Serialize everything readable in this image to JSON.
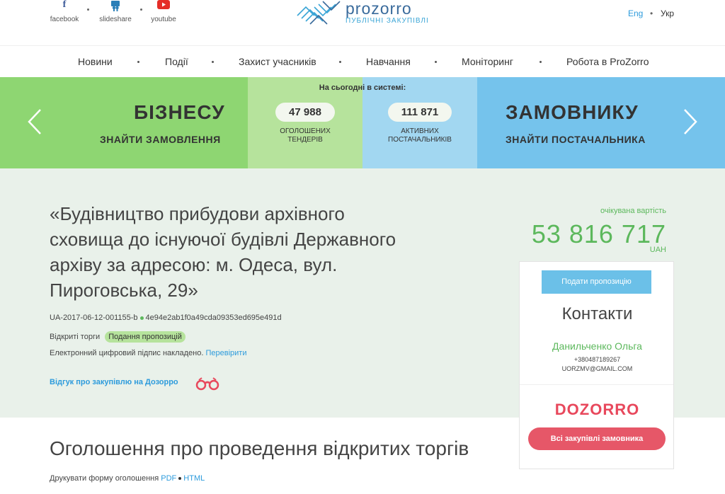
{
  "header": {
    "social": [
      {
        "label": "facebook",
        "icon": "facebook-icon"
      },
      {
        "label": "slideshare",
        "icon": "slideshare-icon"
      },
      {
        "label": "youtube",
        "icon": "youtube-icon"
      }
    ],
    "logo_name": "prozorro",
    "logo_sub": "ПУБЛІЧНІ ЗАКУПІВЛІ",
    "lang_en": "Eng",
    "lang_uk": "Укр"
  },
  "nav": {
    "items": [
      "Новини",
      "Події",
      "Захист учасників",
      "Навчання",
      "Моніторинг",
      "Робота в ProZorro"
    ]
  },
  "banner": {
    "business_title": "БІЗНЕСУ",
    "business_sub": "ЗНАЙТИ ЗАМОВЛЕННЯ",
    "stats_header": "На сьогодні в системі:",
    "tenders_count": "47 988",
    "tenders_label_1": "ОГОЛОШЕНИХ",
    "tenders_label_2": "ТЕНДЕРІВ",
    "suppliers_count": "111 871",
    "suppliers_label_1": "АКТИВНИХ",
    "suppliers_label_2": "ПОСТАЧАЛЬНИКІВ",
    "customer_title": "ЗАМОВНИКУ",
    "customer_sub": "ЗНАЙТИ ПОСТАЧАЛЬНИКА"
  },
  "tender": {
    "title": "«Будівництво прибудови архівного сховища до існуючої будівлі Державного архіву за адресою: м. Одеса, вул. Пироговська, 29»",
    "id": "UA-2017-06-12-001155-b",
    "hash": "4e94e2ab1f0a49cda09353ed695e491d",
    "type": "Відкриті торги",
    "status": "Подання пропозицій",
    "sign_text": "Електронний цифровий підпис накладено.",
    "sign_link": "Перевірити",
    "review_link": "Відгук про закупівлю на Дозорро",
    "expected_label": "очікувана вартість",
    "expected_value": "53 816 717",
    "currency": "UAH"
  },
  "contacts": {
    "submit_button": "Подати пропозицію",
    "title": "Контакти",
    "name": "Данильченко Ольга",
    "phone": "+380487189267",
    "email": "UORZMV@GMAIL.COM",
    "dozorro_logo": "DOZORRO",
    "all_purchases_button": "Всі закупівлі замовника"
  },
  "announcement": {
    "title": "Оголошення про проведення відкритих торгів",
    "print_text": "Друкувати форму оголошення",
    "print_pdf": "PDF",
    "print_html": "HTML"
  },
  "colors": {
    "green": "#8ed672",
    "light_green": "#b6e39c",
    "light_blue": "#a2d7f1",
    "blue": "#75c3ec",
    "accent_green": "#5cb85c",
    "link_blue": "#2d9bdc",
    "dozorro_red": "#e65768"
  }
}
